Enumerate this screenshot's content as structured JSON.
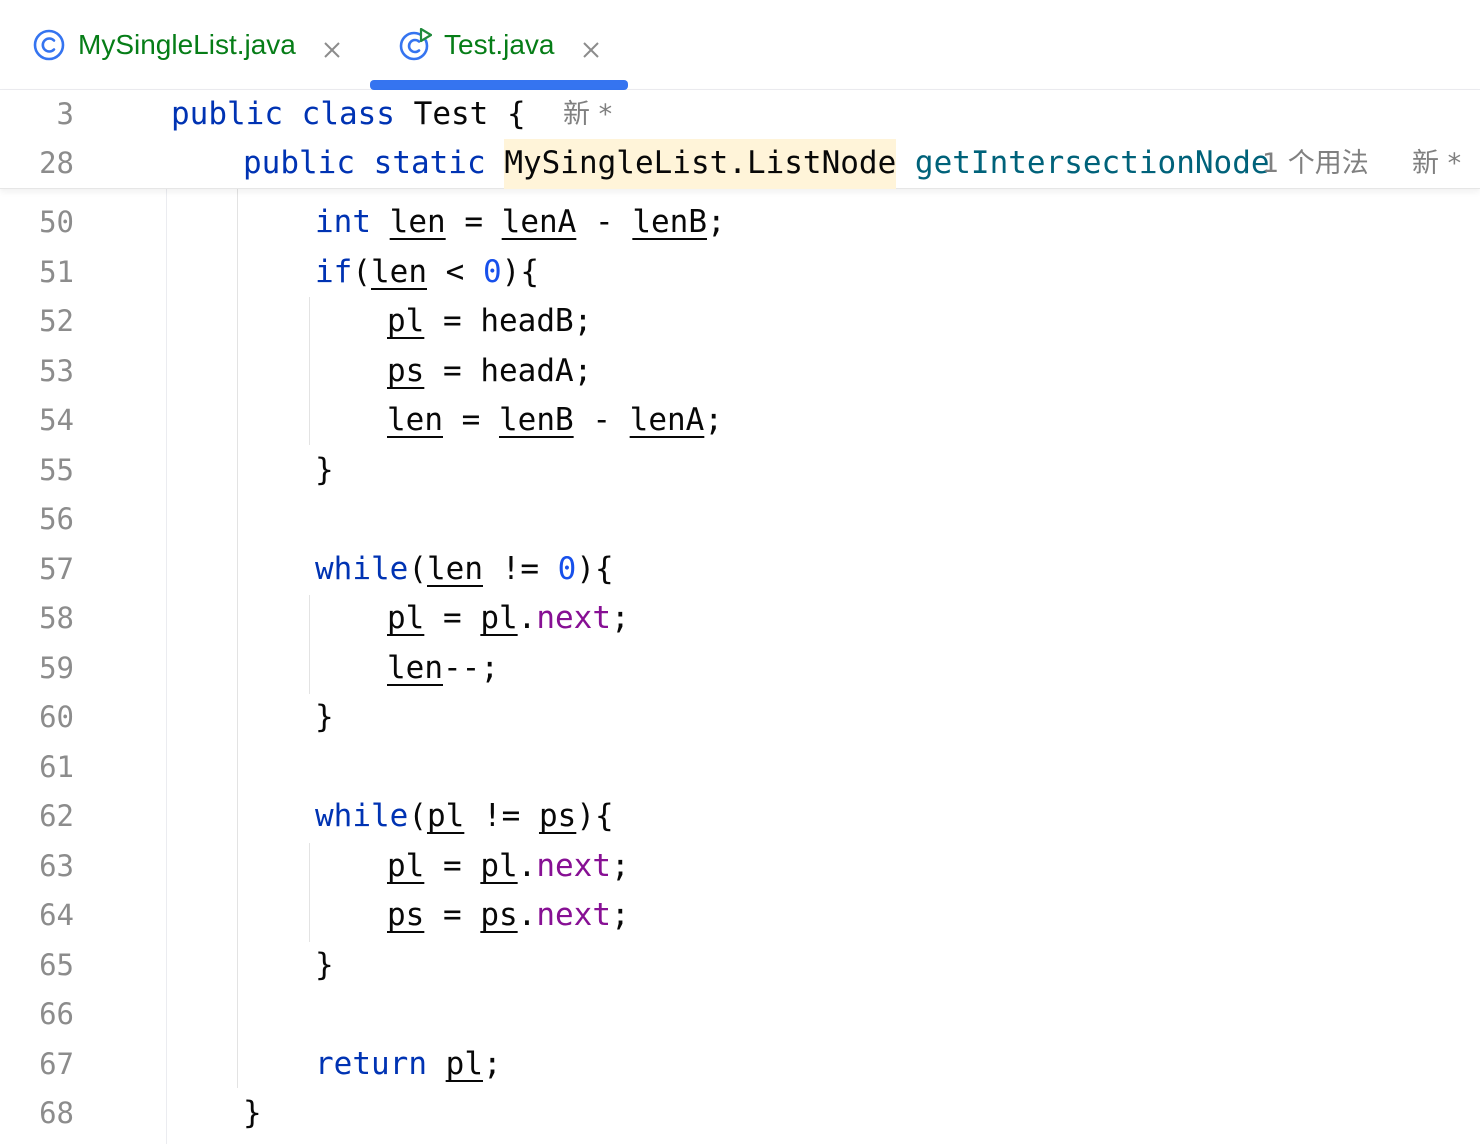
{
  "tabs": [
    {
      "name": "MySingleList.java",
      "active": false
    },
    {
      "name": "Test.java",
      "active": true
    }
  ],
  "sticky": {
    "class_line": {
      "number": "3",
      "kw1": "public",
      "kw2": "class",
      "name": "Test",
      "brace": "{",
      "hint": "新 *"
    },
    "method_line": {
      "number": "28",
      "kw1": "public",
      "kw2": "static",
      "type": "MySingleList.ListNode",
      "method": "getIntersectionNode",
      "usages": "1 个用法",
      "hint": "新 *"
    }
  },
  "lines": {
    "l50": {
      "number": "50",
      "kw": "int",
      "v1": "len",
      "op": " = ",
      "v2": "lenA",
      "op2": " - ",
      "v3": "lenB",
      "end": ";"
    },
    "l51": {
      "number": "51",
      "kw": "if",
      "open": "(",
      "v1": "len",
      "op": " < ",
      "num": "0",
      "end": "){"
    },
    "l52": {
      "number": "52",
      "v1": "pl",
      "op": " = ",
      "v2": "headB;"
    },
    "l53": {
      "number": "53",
      "v1": "ps",
      "op": " = ",
      "v2": "headA;"
    },
    "l54": {
      "number": "54",
      "v1": "len",
      "op": " = ",
      "v2": "lenB",
      "op2": " - ",
      "v3": "lenA",
      "end": ";"
    },
    "l55": {
      "number": "55",
      "text": "}"
    },
    "l56": {
      "number": "56"
    },
    "l57": {
      "number": "57",
      "kw": "while",
      "open": "(",
      "v1": "len",
      "op": " != ",
      "num": "0",
      "end": "){"
    },
    "l58": {
      "number": "58",
      "v1": "pl",
      "op": " = ",
      "v2": "pl",
      "dot": ".",
      "fld": "next",
      "end": ";"
    },
    "l59": {
      "number": "59",
      "v1": "len",
      "end": "--;"
    },
    "l60": {
      "number": "60",
      "text": "}"
    },
    "l61": {
      "number": "61"
    },
    "l62": {
      "number": "62",
      "kw": "while",
      "open": "(",
      "v1": "pl",
      "op": " != ",
      "v2": "ps",
      "end": "){"
    },
    "l63": {
      "number": "63",
      "v1": "pl",
      "op": " = ",
      "v2": "pl",
      "dot": ".",
      "fld": "next",
      "end": ";"
    },
    "l64": {
      "number": "64",
      "v1": "ps",
      "op": " = ",
      "v2": "ps",
      "dot": ".",
      "fld": "next",
      "end": ";"
    },
    "l65": {
      "number": "65",
      "text": "}"
    },
    "l66": {
      "number": "66"
    },
    "l67": {
      "number": "67",
      "kw": "return",
      "sp": " ",
      "v1": "pl",
      "end": ";"
    },
    "l68": {
      "number": "68",
      "text": "}"
    }
  }
}
